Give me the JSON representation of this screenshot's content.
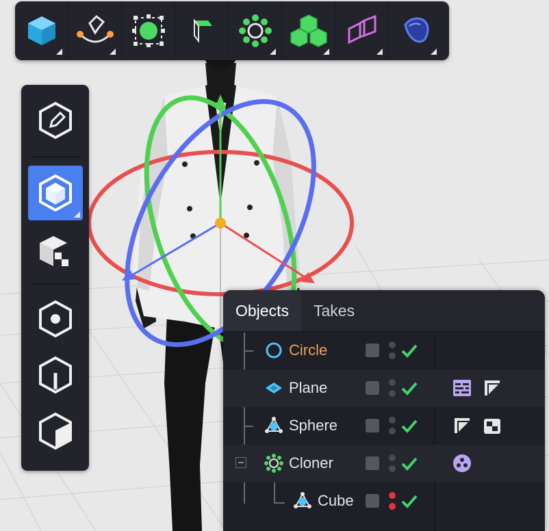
{
  "top_toolbar": {
    "buttons": [
      {
        "icon": "cube-icon",
        "color": "#4fc3f7"
      },
      {
        "icon": "pen-spline-icon",
        "color": "#ffa040"
      },
      {
        "icon": "generator-circle-icon",
        "color": "#4cd964"
      },
      {
        "icon": "subdivision-cube-icon",
        "color": "#4cd964"
      },
      {
        "icon": "cloner-gear-icon",
        "color": "#4cd964"
      },
      {
        "icon": "blocks-icon",
        "color": "#4cd964"
      },
      {
        "icon": "deformer-icon",
        "color": "#d070e0"
      },
      {
        "icon": "field-icon",
        "color": "#5a7cf0"
      }
    ]
  },
  "left_palette": {
    "buttons": [
      {
        "icon": "edit-hex-icon",
        "active": false
      },
      {
        "icon": "model-cube-icon",
        "active": true
      },
      {
        "icon": "polygon-mode-icon",
        "active": false
      },
      {
        "icon": "point-mode-icon",
        "active": false
      },
      {
        "icon": "edge-mode-icon",
        "active": false
      },
      {
        "icon": "face-mode-icon",
        "active": false
      }
    ],
    "active_color": "#4a7ff0"
  },
  "object_manager": {
    "tabs": [
      {
        "label": "Objects",
        "active": true
      },
      {
        "label": "Takes",
        "active": false
      }
    ],
    "rows": [
      {
        "name": "Circle",
        "icon": "circle-spline-icon",
        "highlighted": true,
        "dots": "gray",
        "tags": []
      },
      {
        "name": "Plane",
        "icon": "plane-icon",
        "highlighted": false,
        "dots": "gray",
        "tags": [
          "texture-tag-icon",
          "phong-tag-icon"
        ]
      },
      {
        "name": "Sphere",
        "icon": "sphere-icon",
        "highlighted": false,
        "dots": "gray",
        "tags": [
          "phong-tag-icon",
          "checker-tag-icon"
        ]
      },
      {
        "name": "Cloner",
        "icon": "cloner-gear-icon",
        "highlighted": false,
        "dots": "gray",
        "tags": [
          "material-ball-icon"
        ]
      },
      {
        "name": "Cube",
        "icon": "cube-object-icon",
        "highlighted": false,
        "dots": "red",
        "tags": []
      }
    ]
  },
  "viewport": {
    "gizmo_colors": {
      "x": "#e85050",
      "y": "#50d050",
      "z": "#5a6ef0",
      "center": "#f0b020"
    }
  }
}
